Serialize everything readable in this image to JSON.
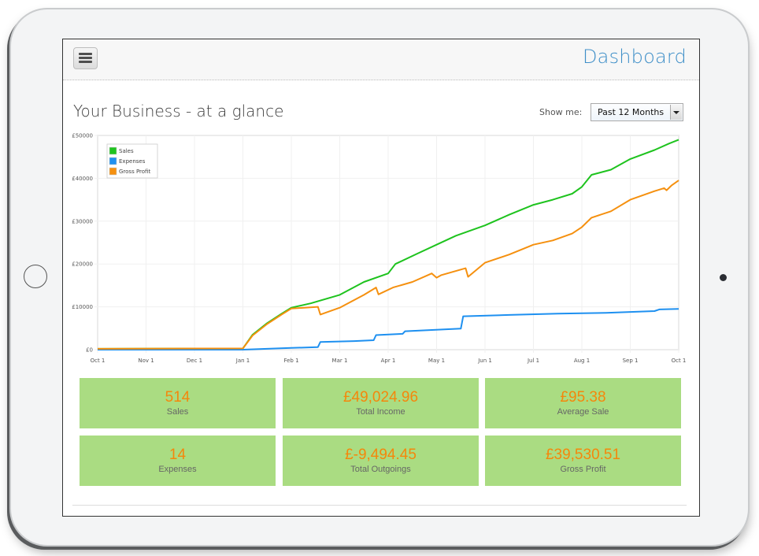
{
  "header": {
    "menu_icon": "hamburger-menu-icon",
    "title": "Dashboard",
    "accent_color": "#3f8fc8"
  },
  "page": {
    "title": "Your Business - at a glance",
    "filter_label": "Show me:",
    "filter_value": "Past 12 Months"
  },
  "stats": [
    {
      "value": "514",
      "label": "Sales"
    },
    {
      "value": "£49,024.96",
      "label": "Total Income"
    },
    {
      "value": "£95.38",
      "label": "Average Sale"
    },
    {
      "value": "14",
      "label": "Expenses"
    },
    {
      "value": "£-9,494.45",
      "label": "Total Outgoings"
    },
    {
      "value": "£39,530.51",
      "label": "Gross Profit"
    }
  ],
  "stat_colors": {
    "card_bg": "#aadc82",
    "value": "#f5870b",
    "label": "#666666"
  },
  "chart_data": {
    "type": "line",
    "title": "",
    "xlabel": "",
    "ylabel": "",
    "x_unit": "months since Oct 1",
    "x_ticks": [
      "Oct 1",
      "Nov 1",
      "Dec 1",
      "Jan 1",
      "Feb 1",
      "Mar 1",
      "Apr 1",
      "May 1",
      "Jun 1",
      "Jul 1",
      "Aug 1",
      "Sep 1",
      "Oct 1"
    ],
    "y_ticks": [
      "£0",
      "£10000",
      "£20000",
      "£30000",
      "£40000",
      "£50000"
    ],
    "ylim": [
      0,
      50000
    ],
    "xlim": [
      0,
      12
    ],
    "grid": true,
    "legend_position": "top-left",
    "series": [
      {
        "name": "Sales",
        "color": "#1ec31e",
        "points": [
          [
            0,
            200
          ],
          [
            3.0,
            300
          ],
          [
            3.2,
            3500
          ],
          [
            3.5,
            6200
          ],
          [
            3.8,
            8400
          ],
          [
            4.0,
            9800
          ],
          [
            4.4,
            10800
          ],
          [
            5.0,
            12800
          ],
          [
            5.5,
            15800
          ],
          [
            6.0,
            17800
          ],
          [
            6.15,
            20000
          ],
          [
            6.6,
            22400
          ],
          [
            7.0,
            24500
          ],
          [
            7.4,
            26600
          ],
          [
            7.8,
            28200
          ],
          [
            8.0,
            29000
          ],
          [
            8.5,
            31500
          ],
          [
            9.0,
            33800
          ],
          [
            9.4,
            35000
          ],
          [
            9.8,
            36400
          ],
          [
            10.0,
            38000
          ],
          [
            10.2,
            40800
          ],
          [
            10.6,
            42000
          ],
          [
            11.0,
            44500
          ],
          [
            11.5,
            46600
          ],
          [
            11.8,
            48100
          ],
          [
            12.0,
            49000
          ]
        ]
      },
      {
        "name": "Expenses",
        "color": "#1e90f0",
        "points": [
          [
            0,
            0
          ],
          [
            3.0,
            0
          ],
          [
            3.5,
            200
          ],
          [
            4.0,
            400
          ],
          [
            4.55,
            600
          ],
          [
            4.6,
            1800
          ],
          [
            5.3,
            2000
          ],
          [
            5.7,
            2200
          ],
          [
            5.75,
            3400
          ],
          [
            6.3,
            3700
          ],
          [
            6.35,
            4300
          ],
          [
            7.5,
            4900
          ],
          [
            7.55,
            7800
          ],
          [
            8.5,
            8100
          ],
          [
            9.5,
            8400
          ],
          [
            10.5,
            8600
          ],
          [
            11.5,
            9000
          ],
          [
            11.6,
            9400
          ],
          [
            12.0,
            9500
          ]
        ]
      },
      {
        "name": "Gross Profit",
        "color": "#f5900f",
        "points": [
          [
            0,
            200
          ],
          [
            3.0,
            300
          ],
          [
            3.2,
            3300
          ],
          [
            3.5,
            6000
          ],
          [
            3.8,
            8200
          ],
          [
            4.0,
            9600
          ],
          [
            4.55,
            10000
          ],
          [
            4.6,
            8200
          ],
          [
            5.0,
            9800
          ],
          [
            5.5,
            12800
          ],
          [
            5.75,
            14500
          ],
          [
            5.8,
            12900
          ],
          [
            6.1,
            14500
          ],
          [
            6.5,
            15800
          ],
          [
            6.9,
            17800
          ],
          [
            7.0,
            16800
          ],
          [
            7.1,
            17400
          ],
          [
            7.6,
            19000
          ],
          [
            7.65,
            17000
          ],
          [
            8.0,
            20300
          ],
          [
            8.5,
            22200
          ],
          [
            9.0,
            24500
          ],
          [
            9.4,
            25500
          ],
          [
            9.8,
            27100
          ],
          [
            10.0,
            28600
          ],
          [
            10.2,
            30800
          ],
          [
            10.6,
            32300
          ],
          [
            11.0,
            35000
          ],
          [
            11.5,
            37000
          ],
          [
            11.7,
            37700
          ],
          [
            11.75,
            37200
          ],
          [
            11.85,
            38300
          ],
          [
            12.0,
            39500
          ]
        ]
      }
    ]
  }
}
